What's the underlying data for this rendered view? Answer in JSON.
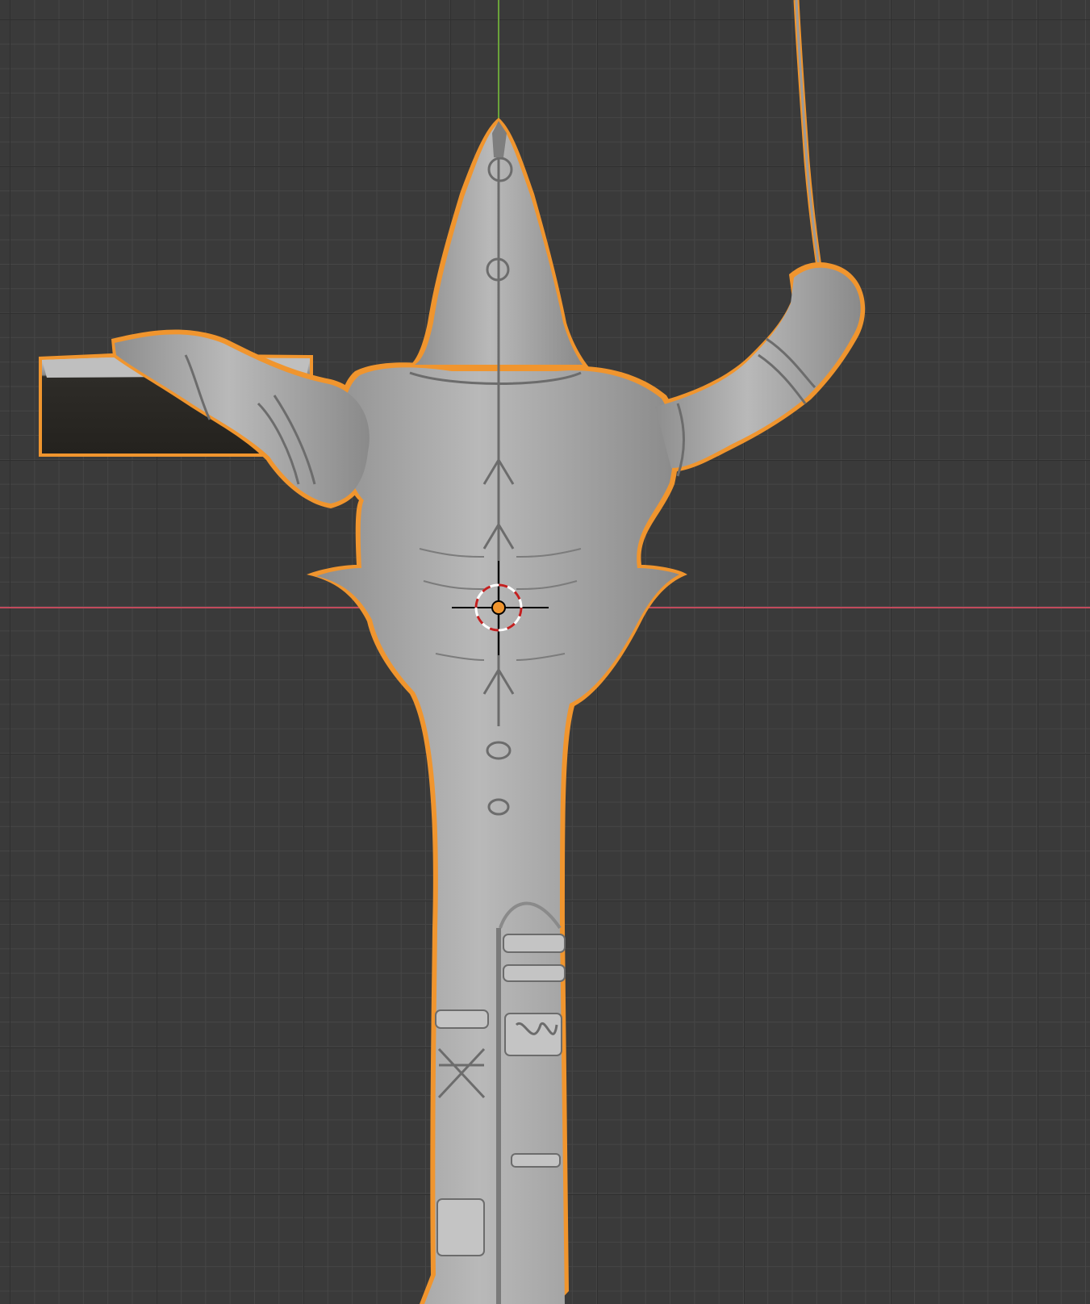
{
  "viewport": {
    "background_color": "#3a3a3a",
    "grid_minor_color": "#464646",
    "grid_major_color": "#303030",
    "x_axis_color": "#c24a5c",
    "y_axis_color": "#6aa23a"
  },
  "object": {
    "selected": true,
    "outline_color": "#f0952e",
    "mesh_color": "#a9a9a9"
  },
  "cursor_3d": {
    "ring_color_1": "#ffffff",
    "ring_color_2": "#c21f1f"
  },
  "origin": {
    "color": "#f0952e"
  }
}
